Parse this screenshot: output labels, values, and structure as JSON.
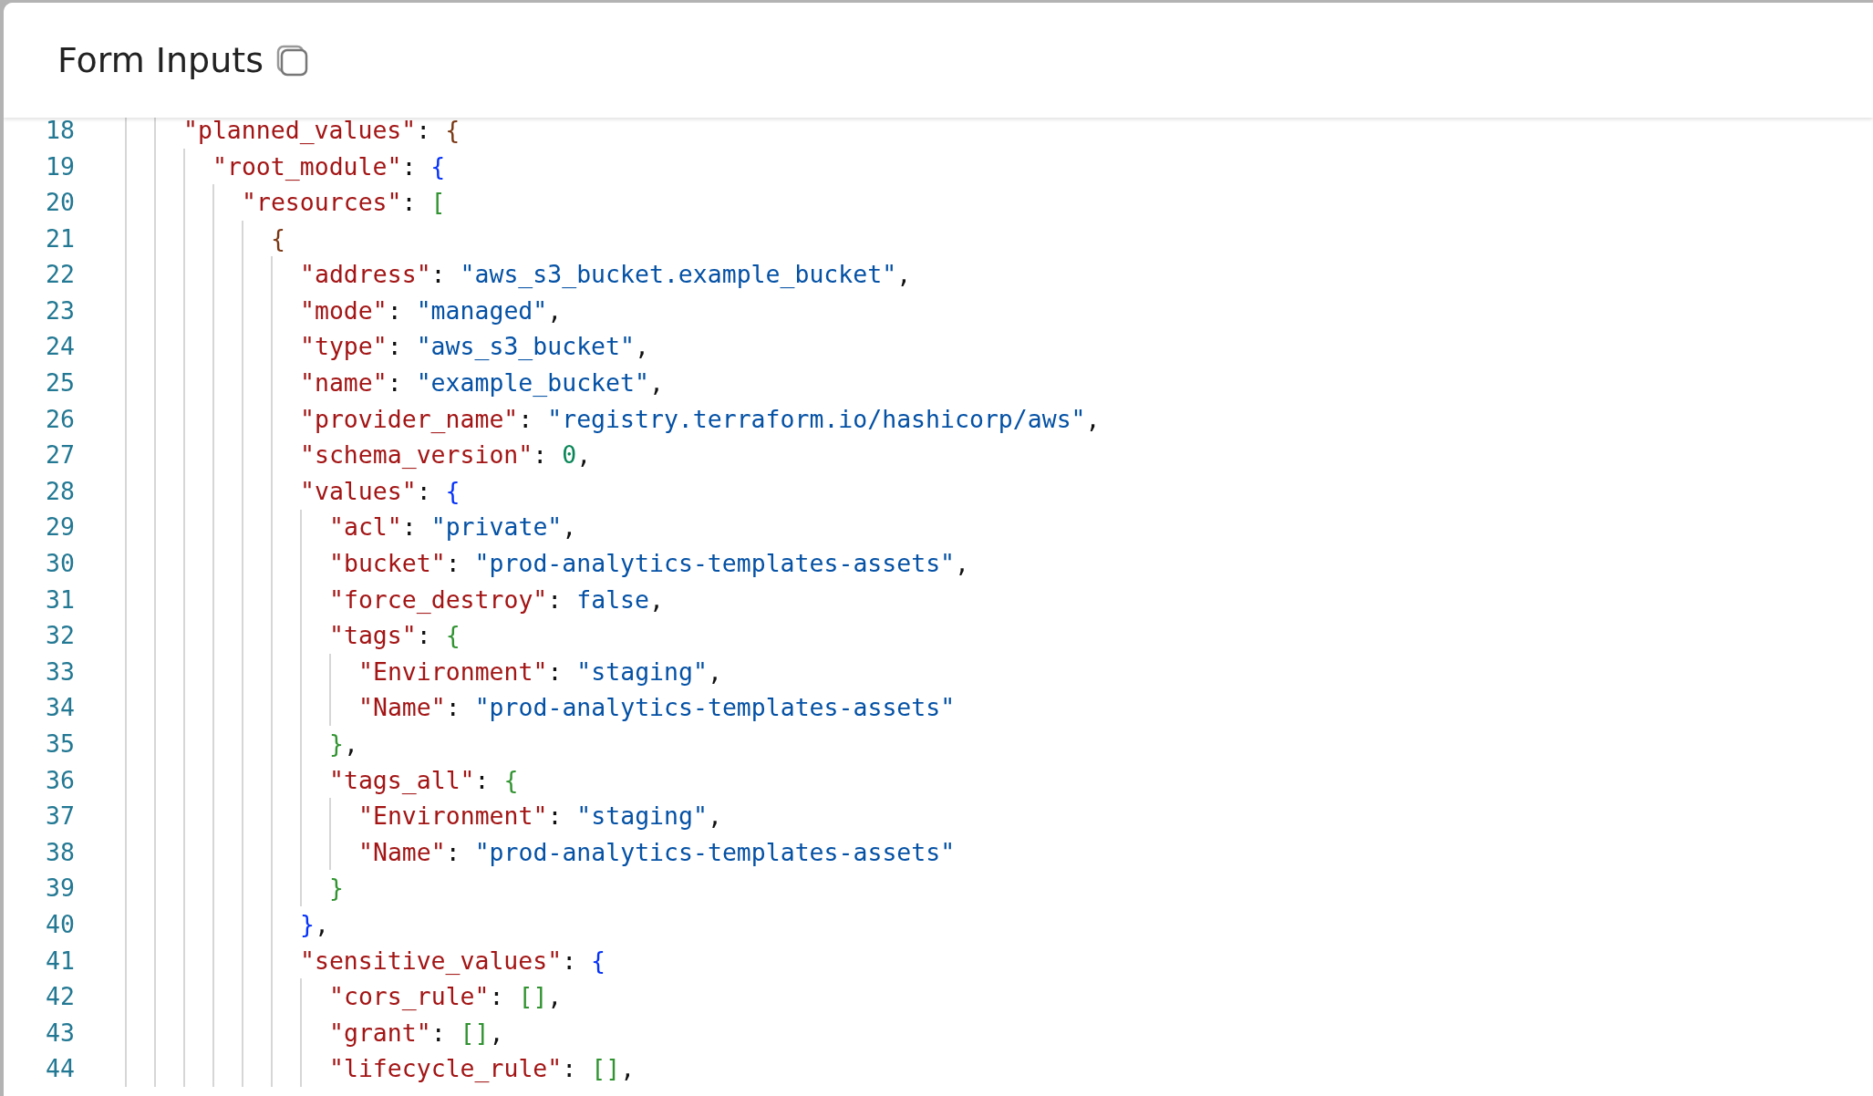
{
  "header": {
    "title": "Form Inputs"
  },
  "code_lines": [
    {
      "number": "18",
      "tokens": [
        {
          "kind": "key",
          "text": "\"planned_values\""
        },
        {
          "kind": "punct",
          "text": ": "
        },
        {
          "kind": "bracket",
          "text": "{"
        }
      ],
      "children": [
        {
          "number": "19",
          "tokens": [
            {
              "kind": "key",
              "text": "\"root_module\""
            },
            {
              "kind": "punct",
              "text": ": "
            },
            {
              "kind": "bracket",
              "text": "{"
            }
          ],
          "children": [
            {
              "number": "20",
              "tokens": [
                {
                  "kind": "key",
                  "text": "\"resources\""
                },
                {
                  "kind": "punct",
                  "text": ": "
                },
                {
                  "kind": "bracket",
                  "text": "["
                }
              ],
              "children": [
                {
                  "number": "21",
                  "tokens": [
                    {
                      "kind": "bracket",
                      "text": "{"
                    }
                  ],
                  "children": [
                    {
                      "number": "22",
                      "tokens": [
                        {
                          "kind": "key",
                          "text": "\"address\""
                        },
                        {
                          "kind": "punct",
                          "text": ": "
                        },
                        {
                          "kind": "string",
                          "text": "\"aws_s3_bucket.example_bucket\""
                        },
                        {
                          "kind": "punct",
                          "text": ","
                        }
                      ]
                    },
                    {
                      "number": "23",
                      "tokens": [
                        {
                          "kind": "key",
                          "text": "\"mode\""
                        },
                        {
                          "kind": "punct",
                          "text": ": "
                        },
                        {
                          "kind": "string",
                          "text": "\"managed\""
                        },
                        {
                          "kind": "punct",
                          "text": ","
                        }
                      ]
                    },
                    {
                      "number": "24",
                      "tokens": [
                        {
                          "kind": "key",
                          "text": "\"type\""
                        },
                        {
                          "kind": "punct",
                          "text": ": "
                        },
                        {
                          "kind": "string",
                          "text": "\"aws_s3_bucket\""
                        },
                        {
                          "kind": "punct",
                          "text": ","
                        }
                      ]
                    },
                    {
                      "number": "25",
                      "tokens": [
                        {
                          "kind": "key",
                          "text": "\"name\""
                        },
                        {
                          "kind": "punct",
                          "text": ": "
                        },
                        {
                          "kind": "string",
                          "text": "\"example_bucket\""
                        },
                        {
                          "kind": "punct",
                          "text": ","
                        }
                      ]
                    },
                    {
                      "number": "26",
                      "tokens": [
                        {
                          "kind": "key",
                          "text": "\"provider_name\""
                        },
                        {
                          "kind": "punct",
                          "text": ": "
                        },
                        {
                          "kind": "string",
                          "text": "\"registry.terraform.io/hashicorp/aws\""
                        },
                        {
                          "kind": "punct",
                          "text": ","
                        }
                      ]
                    },
                    {
                      "number": "27",
                      "tokens": [
                        {
                          "kind": "key",
                          "text": "\"schema_version\""
                        },
                        {
                          "kind": "punct",
                          "text": ": "
                        },
                        {
                          "kind": "number",
                          "text": "0"
                        },
                        {
                          "kind": "punct",
                          "text": ","
                        }
                      ]
                    },
                    {
                      "number": "28",
                      "tokens": [
                        {
                          "kind": "key",
                          "text": "\"values\""
                        },
                        {
                          "kind": "punct",
                          "text": ": "
                        },
                        {
                          "kind": "bracket",
                          "text": "{"
                        }
                      ],
                      "children": [
                        {
                          "number": "29",
                          "tokens": [
                            {
                              "kind": "key",
                              "text": "\"acl\""
                            },
                            {
                              "kind": "punct",
                              "text": ": "
                            },
                            {
                              "kind": "string",
                              "text": "\"private\""
                            },
                            {
                              "kind": "punct",
                              "text": ","
                            }
                          ]
                        },
                        {
                          "number": "30",
                          "tokens": [
                            {
                              "kind": "key",
                              "text": "\"bucket\""
                            },
                            {
                              "kind": "punct",
                              "text": ": "
                            },
                            {
                              "kind": "string",
                              "text": "\"prod-analytics-templates-assets\""
                            },
                            {
                              "kind": "punct",
                              "text": ","
                            }
                          ]
                        },
                        {
                          "number": "31",
                          "tokens": [
                            {
                              "kind": "key",
                              "text": "\"force_destroy\""
                            },
                            {
                              "kind": "punct",
                              "text": ": "
                            },
                            {
                              "kind": "keyword",
                              "text": "false"
                            },
                            {
                              "kind": "punct",
                              "text": ","
                            }
                          ]
                        },
                        {
                          "number": "32",
                          "tokens": [
                            {
                              "kind": "key",
                              "text": "\"tags\""
                            },
                            {
                              "kind": "punct",
                              "text": ": "
                            },
                            {
                              "kind": "bracket",
                              "text": "{"
                            }
                          ],
                          "children": [
                            {
                              "number": "33",
                              "tokens": [
                                {
                                  "kind": "key",
                                  "text": "\"Environment\""
                                },
                                {
                                  "kind": "punct",
                                  "text": ": "
                                },
                                {
                                  "kind": "string",
                                  "text": "\"staging\""
                                },
                                {
                                  "kind": "punct",
                                  "text": ","
                                }
                              ]
                            },
                            {
                              "number": "34",
                              "tokens": [
                                {
                                  "kind": "key",
                                  "text": "\"Name\""
                                },
                                {
                                  "kind": "punct",
                                  "text": ": "
                                },
                                {
                                  "kind": "string",
                                  "text": "\"prod-analytics-templates-assets\""
                                }
                              ]
                            }
                          ]
                        },
                        {
                          "number": "35",
                          "tokens": [
                            {
                              "kind": "bracket",
                              "text": "}"
                            },
                            {
                              "kind": "punct",
                              "text": ","
                            }
                          ]
                        },
                        {
                          "number": "36",
                          "tokens": [
                            {
                              "kind": "key",
                              "text": "\"tags_all\""
                            },
                            {
                              "kind": "punct",
                              "text": ": "
                            },
                            {
                              "kind": "bracket",
                              "text": "{"
                            }
                          ],
                          "children": [
                            {
                              "number": "37",
                              "tokens": [
                                {
                                  "kind": "key",
                                  "text": "\"Environment\""
                                },
                                {
                                  "kind": "punct",
                                  "text": ": "
                                },
                                {
                                  "kind": "string",
                                  "text": "\"staging\""
                                },
                                {
                                  "kind": "punct",
                                  "text": ","
                                }
                              ]
                            },
                            {
                              "number": "38",
                              "tokens": [
                                {
                                  "kind": "key",
                                  "text": "\"Name\""
                                },
                                {
                                  "kind": "punct",
                                  "text": ": "
                                },
                                {
                                  "kind": "string",
                                  "text": "\"prod-analytics-templates-assets\""
                                }
                              ]
                            }
                          ]
                        },
                        {
                          "number": "39",
                          "tokens": [
                            {
                              "kind": "bracket",
                              "text": "}"
                            }
                          ]
                        }
                      ]
                    },
                    {
                      "number": "40",
                      "tokens": [
                        {
                          "kind": "bracket",
                          "text": "}"
                        },
                        {
                          "kind": "punct",
                          "text": ","
                        }
                      ]
                    },
                    {
                      "number": "41",
                      "tokens": [
                        {
                          "kind": "key",
                          "text": "\"sensitive_values\""
                        },
                        {
                          "kind": "punct",
                          "text": ": "
                        },
                        {
                          "kind": "bracket",
                          "text": "{"
                        }
                      ],
                      "children": [
                        {
                          "number": "42",
                          "tokens": [
                            {
                              "kind": "key",
                              "text": "\"cors_rule\""
                            },
                            {
                              "kind": "punct",
                              "text": ": "
                            },
                            {
                              "kind": "bracket",
                              "text": "[]"
                            },
                            {
                              "kind": "punct",
                              "text": ","
                            }
                          ]
                        },
                        {
                          "number": "43",
                          "tokens": [
                            {
                              "kind": "key",
                              "text": "\"grant\""
                            },
                            {
                              "kind": "punct",
                              "text": ": "
                            },
                            {
                              "kind": "bracket",
                              "text": "[]"
                            },
                            {
                              "kind": "punct",
                              "text": ","
                            }
                          ]
                        },
                        {
                          "number": "44",
                          "tokens": [
                            {
                              "kind": "key",
                              "text": "\"lifecycle_rule\""
                            },
                            {
                              "kind": "punct",
                              "text": ": "
                            },
                            {
                              "kind": "bracket",
                              "text": "[]"
                            },
                            {
                              "kind": "punct",
                              "text": ","
                            }
                          ]
                        }
                      ]
                    }
                  ]
                }
              ]
            }
          ]
        }
      ]
    }
  ]
}
